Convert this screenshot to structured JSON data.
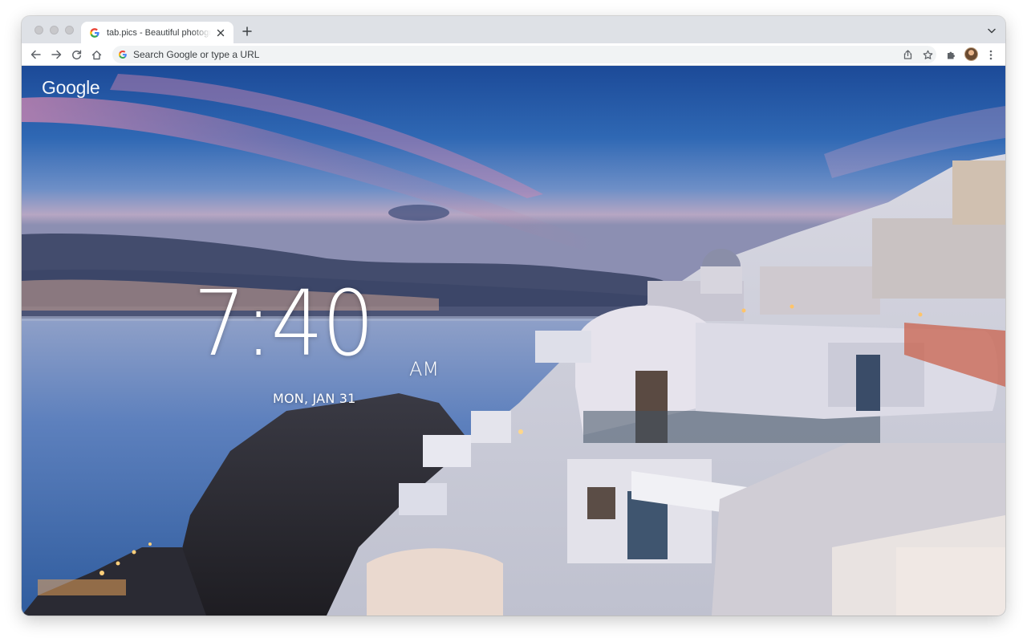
{
  "browser": {
    "tab": {
      "title": "tab.pics - Beautiful photographs",
      "favicon": "google-g-icon"
    },
    "new_tab_icon": "plus-icon",
    "tab_search_icon": "chevron-down-icon",
    "toolbar": {
      "back_icon": "arrow-left-icon",
      "forward_icon": "arrow-right-icon",
      "reload_icon": "reload-icon",
      "home_icon": "home-icon",
      "omnibox_placeholder": "Search Google or type a URL",
      "share_icon": "share-icon",
      "bookmark_icon": "star-icon",
      "extensions_icon": "puzzle-icon",
      "profile_icon": "avatar",
      "menu_icon": "kebab-menu-icon"
    }
  },
  "newtab": {
    "logo": "Google",
    "time": "7:40",
    "ampm": "AM",
    "date": "MON, JAN 31"
  },
  "colors": {
    "tabstrip_bg": "#dee1e6",
    "toolbar_bg": "#ffffff",
    "omnibox_bg": "#f1f3f4",
    "sky_top": "#1f4f9c",
    "sea": "#5b7fb8"
  }
}
